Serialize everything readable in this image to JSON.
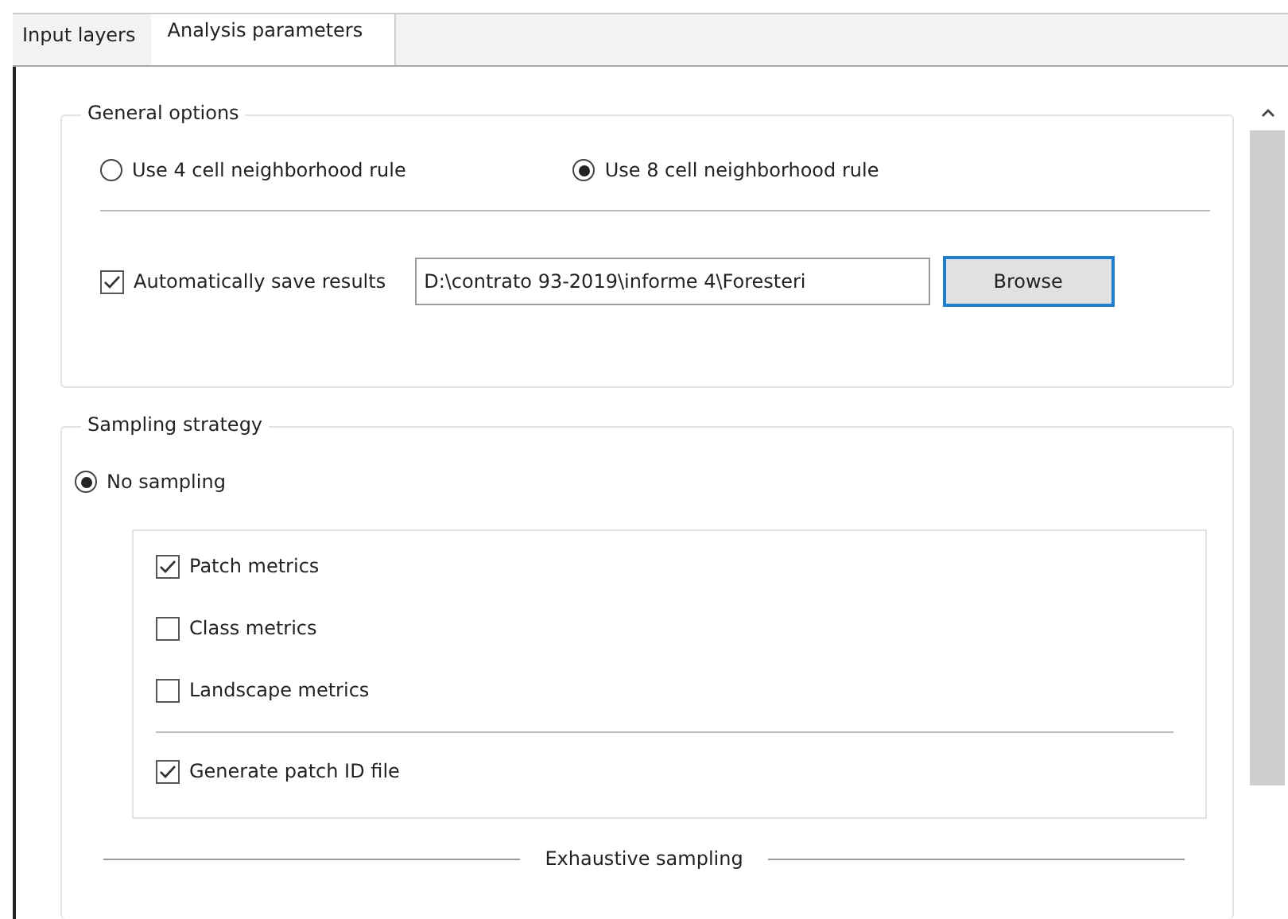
{
  "tabs": [
    {
      "label": "Input layers",
      "selected": false
    },
    {
      "label": "Analysis parameters",
      "selected": true
    }
  ],
  "general_options": {
    "title": "General options",
    "neighborhood_rules": [
      {
        "label": "Use 4 cell neighborhood rule",
        "selected": false
      },
      {
        "label": "Use 8 cell neighborhood rule",
        "selected": true
      }
    ],
    "auto_save": {
      "label": "Automatically save results",
      "checked": true
    },
    "path_field": {
      "value": "D:\\contrato 93-2019\\informe 4\\Foresteri"
    },
    "browse_button": {
      "label": "Browse"
    }
  },
  "sampling_strategy": {
    "title": "Sampling strategy",
    "options": [
      {
        "label": "No sampling",
        "selected": true
      }
    ],
    "metrics": [
      {
        "label": "Patch metrics",
        "checked": true
      },
      {
        "label": "Class metrics",
        "checked": false
      },
      {
        "label": "Landscape metrics",
        "checked": false
      }
    ],
    "patch_id_file": {
      "label": "Generate patch ID file",
      "checked": true
    },
    "exhaustive_sampling": {
      "title": "Exhaustive sampling"
    }
  }
}
